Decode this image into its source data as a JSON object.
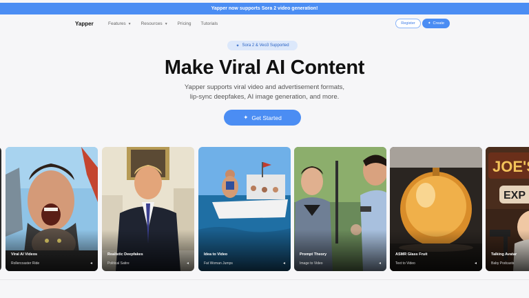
{
  "banner": {
    "text": "Yapper now supports Sora 2 video generation!"
  },
  "nav": {
    "logo": "Yapper",
    "links": [
      "Features",
      "Resources",
      "Pricing",
      "Tutorials"
    ],
    "register": "Register",
    "create": "Create"
  },
  "hero": {
    "badge": "Sora 2 & Veo3 Supported",
    "title": "Make Viral AI Content",
    "subtitle_line1": "Yapper supports viral video and advertisement formats,",
    "subtitle_line2": "lip-sync deepfakes, AI image generation, and more.",
    "cta": "Get Started"
  },
  "cards": [
    {
      "title": "Viral AI Videos",
      "subtitle": "Rollercoaster Ride"
    },
    {
      "title": "Realistic Deepfakes",
      "subtitle": "Political Satire"
    },
    {
      "title": "Idea to Video",
      "subtitle": "Fat Woman Jumps"
    },
    {
      "title": "Prompt Theory",
      "subtitle": "Image to Video"
    },
    {
      "title": "ASMR Glass Fruit",
      "subtitle": "Text to Video"
    },
    {
      "title": "Talking Avatar",
      "subtitle": "Baby Podcasts"
    }
  ],
  "colors": {
    "accent": "#4b8df3",
    "badge_bg": "#dce8fb"
  }
}
